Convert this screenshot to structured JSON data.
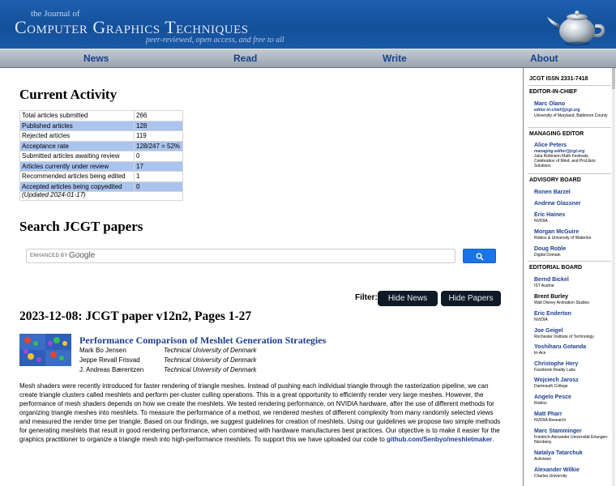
{
  "header": {
    "the_journal_of": "the Journal of",
    "title": "Computer Graphics Techniques",
    "tagline": "peer-reviewed, open access, and free to all"
  },
  "nav": {
    "news": "News",
    "read": "Read",
    "write": "Write",
    "about": "About"
  },
  "activity": {
    "title": "Current Activity",
    "rows": [
      {
        "label": "Total articles submitted",
        "value": "266"
      },
      {
        "label": "Published articles",
        "value": "128"
      },
      {
        "label": "Rejected articles",
        "value": "119"
      },
      {
        "label": "Acceptance rate",
        "value": "128/247 = 52%"
      },
      {
        "label": "Submitted articles awaiting review",
        "value": "0"
      },
      {
        "label": "Articles currently under review",
        "value": "17"
      },
      {
        "label": "Recommended articles being edited",
        "value": "1"
      },
      {
        "label": "Accepted articles being copyedited",
        "value": "0"
      }
    ],
    "updated": "(Updated 2024-01-17)"
  },
  "search": {
    "title": "Search JCGT papers",
    "enhanced_by": "ENHANCED BY",
    "google": "Google"
  },
  "filter": {
    "label": "Filter:",
    "hide_news": "Hide News",
    "hide_papers": "Hide Papers"
  },
  "paper": {
    "heading": "2023-12-08: JCGT paper v12n2, Pages 1-27",
    "title": "Performance Comparison of Meshlet Generation Strategies",
    "authors": [
      {
        "name": "Mark Bo Jensen",
        "affiliation": "Technical University of Denmark"
      },
      {
        "name": "Jeppe Revall Frisvad",
        "affiliation": "Technical University of Denmark"
      },
      {
        "name": "J. Andreas Bærentzen",
        "affiliation": "Technical University of Denmark"
      }
    ],
    "abstract": "Mesh shaders were recently introduced for faster rendering of triangle meshes. Instead of pushing each individual triangle through the rasterization pipeline, we can create triangle clusters called meshlets and perform per-cluster culling operations. This is a great opportunity to efficiently render very large meshes. However, the performance of mesh shaders depends on how we create the meshlets. We tested rendering performance, on NVIDIA hardware, after the use of different methods for organizing triangle meshes into meshlets. To measure the performance of a method, we rendered meshes of different complexity from many randomly selected views and measured the render time per triangle. Based on our findings, we suggest guidelines for creation of meshlets. Using our guidelines we propose two simple methods for generating meshlets that result in good rendering performance, when combined with hardware manufactures best practices. Our objective is to make it easier for the graphics practitioner to organize a triangle mesh into high-performance meshlets. To support this we have uploaded our code to ",
    "code_link": "github.com/Senbyo/meshletmaker",
    "abstract_end": "."
  },
  "sidebar": {
    "issn": "JCGT ISSN 2331-7418",
    "editor_in_chief_heading": "EDITOR-IN-CHIEF",
    "editor_in_chief": {
      "name": "Marc Olano",
      "email": "editor-in-chief@jcgt.org",
      "affiliation": "University of Maryland, Baltimore County"
    },
    "managing_editor_heading": "MANAGING EDITOR",
    "managing_editor": {
      "name": "Alice Peters",
      "email": "managing-editor@jcgt.org",
      "affiliation": "Julia Robinson Math Festivals, Celebration of Mind, and ProLibris Solutions"
    },
    "advisory_board_heading": "ADVISORY BOARD",
    "advisory_board": [
      {
        "name": "Ronen Barzel",
        "affiliation": ""
      },
      {
        "name": "Andrew Glassner",
        "affiliation": ""
      },
      {
        "name": "Eric Haines",
        "affiliation": "NVIDIA"
      },
      {
        "name": "Morgan McGuire",
        "affiliation": "Roblox & University of Waterloo"
      },
      {
        "name": "Doug Roble",
        "affiliation": "Digital Domain"
      }
    ],
    "editorial_board_heading": "EDITORIAL BOARD",
    "editorial_board": [
      {
        "name": "Bernd Bickel",
        "affiliation": "IST Austria"
      },
      {
        "name": "Brent Burley",
        "affiliation": "Walt Disney Animation Studios"
      },
      {
        "name": "Eric Enderton",
        "affiliation": "NVIDIA"
      },
      {
        "name": "Joe Geigel",
        "affiliation": "Rochester Institute of Technology"
      },
      {
        "name": "Yoshiharu Gotanda",
        "affiliation": "tri-Ace"
      },
      {
        "name": "Christophe Hery",
        "affiliation": "Facebook Reality Labs"
      },
      {
        "name": "Wojciech Jarosz",
        "affiliation": "Dartmouth College"
      },
      {
        "name": "Angelo Pesce",
        "affiliation": "Roblox"
      },
      {
        "name": "Matt Pharr",
        "affiliation": "NVIDIA Research"
      },
      {
        "name": "Marc Stamminger",
        "affiliation": "Friedrich-Alexander Universität Erlangen-Nürnberg"
      },
      {
        "name": "Natalya Tatarchuk",
        "affiliation": "Activision"
      },
      {
        "name": "Alexander Wilkie",
        "affiliation": "Charles University"
      }
    ]
  },
  "colors": {
    "banner_blue": "#1a5aa8",
    "link_blue": "#1c3f8f",
    "table_highlight": "#aac4ef",
    "google_button": "#1a73e8",
    "filter_pill": "#0f1a25"
  }
}
